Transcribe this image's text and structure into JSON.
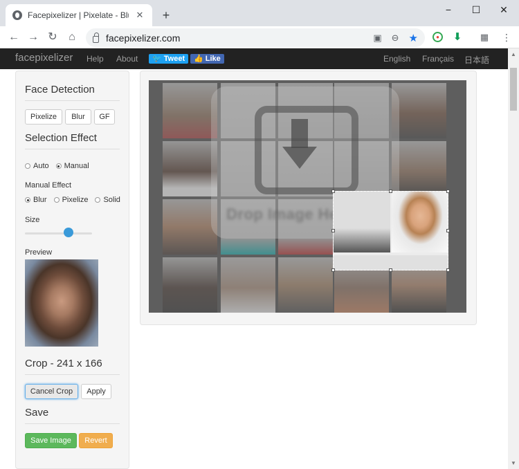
{
  "browser": {
    "tab_title": "Facepixelizer | Pixelate - Blur - A",
    "new_tab_label": "+",
    "tab_close_label": "✕",
    "url": "facepixelizer.com",
    "window_controls": [
      "−",
      "☐",
      "✕"
    ]
  },
  "site_nav": {
    "brand": "facepixelizer",
    "links": [
      "Help",
      "About"
    ],
    "tweet_label": "Tweet",
    "like_label": "Like",
    "languages": [
      "English",
      "Français",
      "日本語"
    ]
  },
  "face_detection": {
    "title": "Face Detection",
    "buttons": [
      "Pixelize",
      "Blur",
      "GF"
    ]
  },
  "selection_effect": {
    "title": "Selection Effect",
    "mode_options": [
      "Auto",
      "Manual"
    ],
    "mode_selected": "Manual",
    "manual_effect_label": "Manual Effect",
    "effect_options": [
      "Blur",
      "Pixelize",
      "Solid"
    ],
    "effect_selected": "Blur",
    "size_label": "Size",
    "size_value": 0.65,
    "preview_label": "Preview"
  },
  "crop": {
    "title": "Crop - 241 x 166",
    "cancel_label": "Cancel Crop",
    "apply_label": "Apply"
  },
  "save": {
    "title": "Save",
    "save_label": "Save Image",
    "revert_label": "Revert"
  },
  "stage": {
    "drop_text": "Drop Image Here"
  },
  "colors": {
    "navbar": "#222222",
    "slider": "#3a9ad9",
    "save_green": "#5cb85c",
    "revert_orange": "#f0ad4e",
    "chrome_accent": "#1a73e8"
  }
}
